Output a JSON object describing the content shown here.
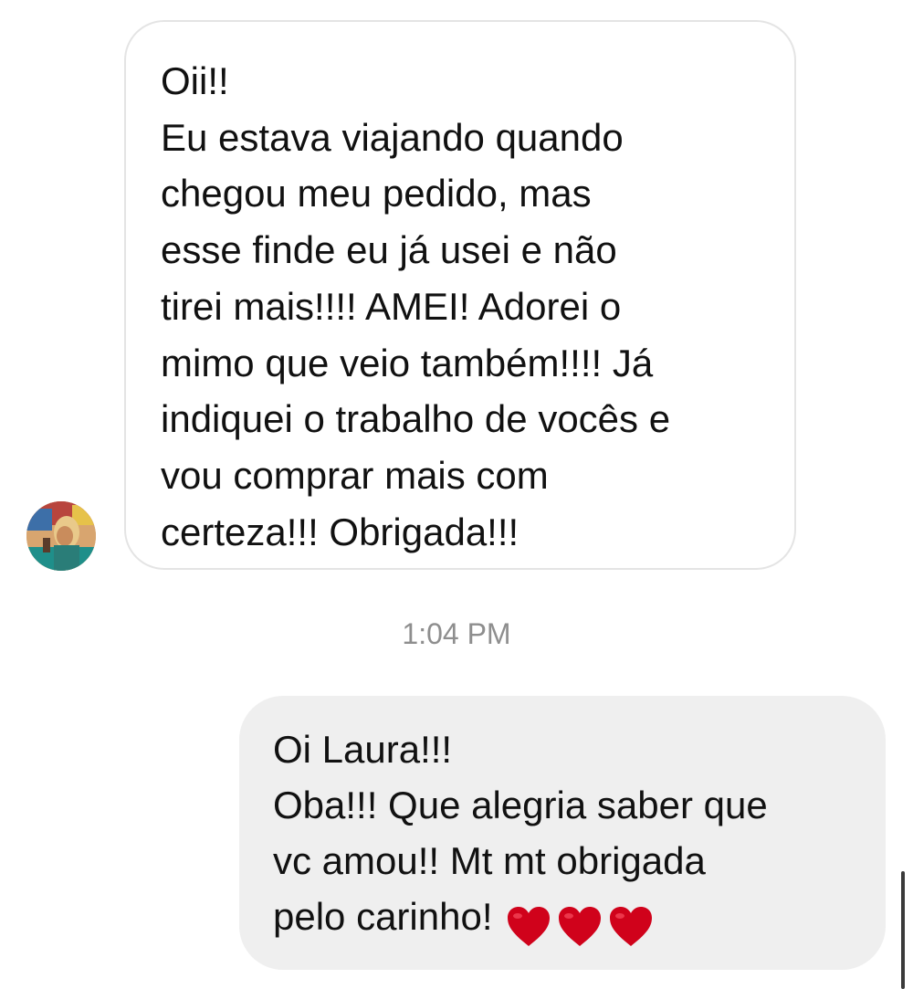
{
  "conversation": {
    "incoming": {
      "lines": [
        "Oii!!",
        "Eu estava viajando quando",
        "chegou meu pedido, mas",
        "esse finde eu já usei e não",
        "tirei mais!!!! AMEI! Adorei o",
        "mimo que veio também!!!! Já",
        "indiquei o trabalho de vocês e",
        "vou comprar mais com",
        "certeza!!! Obrigada!!!"
      ]
    },
    "timestamp": "1:04 PM",
    "outgoing": {
      "lines": [
        "Oi Laura!!!",
        "Oba!!! Que alegria saber que",
        "vc amou!! Mt mt obrigada",
        "pelo carinho!"
      ],
      "emoji": [
        "red-heart",
        "red-heart",
        "red-heart"
      ]
    }
  },
  "colors": {
    "incoming_border": "#e4e4e4",
    "outgoing_bg": "#efefef",
    "timestamp": "#8e8e8e",
    "heart": "#d0021b"
  }
}
